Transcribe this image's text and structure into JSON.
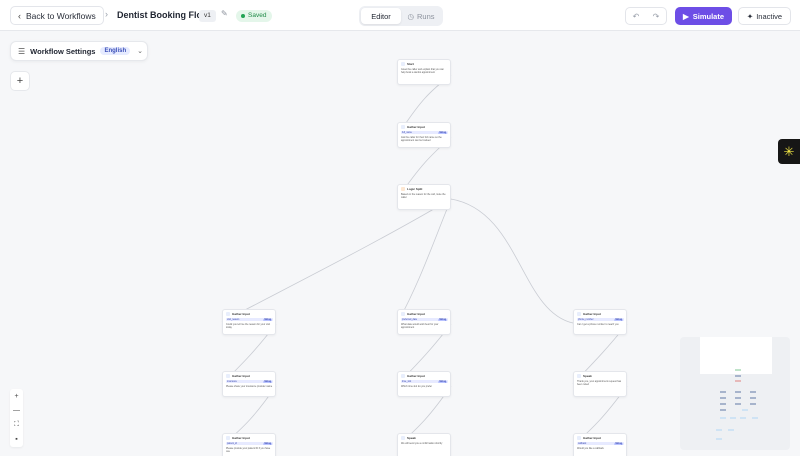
{
  "header": {
    "back_label": "Back to Workflows",
    "title": "Dentist Booking Flow",
    "version": "v1",
    "status": "Saved",
    "tabs": [
      {
        "label": "Editor"
      },
      {
        "label": "Runs"
      }
    ],
    "simulate_label": "Simulate",
    "inactive_label": "Inactive"
  },
  "settings": {
    "label": "Workflow Settings",
    "language": "English"
  },
  "nodes": [
    {
      "title": "Start",
      "text": "Greet the caller and explain that you can help book a dentist appointment"
    },
    {
      "title": "Gather Input",
      "var": "full_name",
      "var_type": "String",
      "text": "Ask the caller for their full name so the appointment can be booked"
    },
    {
      "title": "Logic Split",
      "text": "Based on the reason for the call, route the caller"
    },
    {
      "title": "Gather Input",
      "var": "visit_reason",
      "var_type": "String",
      "text": "Could you tell me the reason for your visit today"
    },
    {
      "title": "Gather Input",
      "var": "preferred_date",
      "var_type": "String",
      "text": "What date would work best for your appointment"
    },
    {
      "title": "Gather Input",
      "var": "phone_number",
      "var_type": "String",
      "text": "Can I get a phone number to reach you"
    },
    {
      "title": "Gather Input",
      "var": "insurance",
      "var_type": "String",
      "text": "Please share your insurance provider name"
    },
    {
      "title": "Gather Input",
      "var": "time_slot",
      "var_type": "String",
      "text": "Which time slot do you prefer"
    },
    {
      "title": "Speak",
      "text": "Thank you, your appointment request has been noted"
    },
    {
      "title": "Gather Input",
      "var": "patient_id",
      "var_type": "String",
      "text": "Please provide your patient ID if you have one"
    },
    {
      "title": "Speak",
      "text": "We will send you a confirmation shortly"
    },
    {
      "title": "Gather Input",
      "var": "callback",
      "var_type": "String",
      "text": "Would you like a callback"
    }
  ]
}
